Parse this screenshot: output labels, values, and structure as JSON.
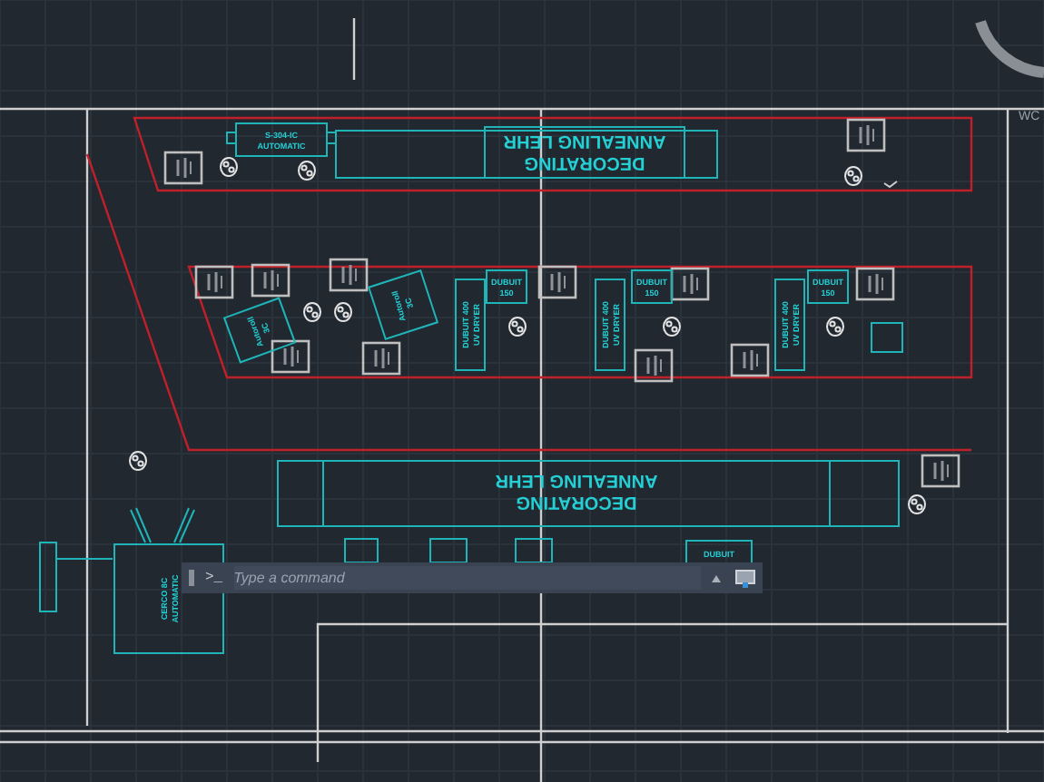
{
  "viewcube_label": "WC",
  "lehrs": [
    {
      "line_1": "DECORATING",
      "line_2": "ANNEALING LEHR"
    },
    {
      "line_1": "DECORATING",
      "line_2": "ANNEALING LEHR"
    }
  ],
  "machines": [
    {
      "kind": "horizontal",
      "lines": [
        "S-304-IC",
        "AUTOMATIC"
      ]
    },
    {
      "kind": "tilted",
      "lines": [
        "Autoroll",
        "3C"
      ]
    },
    {
      "kind": "tilted",
      "lines": [
        "Autoroll",
        "3C"
      ]
    },
    {
      "kind": "horizontal",
      "lines": [
        "DUBUIT",
        "150"
      ]
    },
    {
      "kind": "horizontal",
      "lines": [
        "DUBUIT",
        "150"
      ]
    },
    {
      "kind": "horizontal",
      "lines": [
        "DUBUIT",
        "150"
      ]
    },
    {
      "kind": "vertical",
      "lines": [
        "DUBUIT 400",
        "UV DRYER"
      ]
    },
    {
      "kind": "vertical",
      "lines": [
        "DUBUIT 400",
        "UV DRYER"
      ]
    },
    {
      "kind": "vertical",
      "lines": [
        "DUBUIT 400",
        "UV DRYER"
      ]
    },
    {
      "kind": "vertical",
      "lines": [
        "CERCO 8C",
        "AUTOMATIC"
      ]
    },
    {
      "kind": "horizontal",
      "lines": [
        "DUBUIT"
      ]
    }
  ],
  "command_line": {
    "prompt": ">_",
    "placeholder": "Type a command"
  }
}
